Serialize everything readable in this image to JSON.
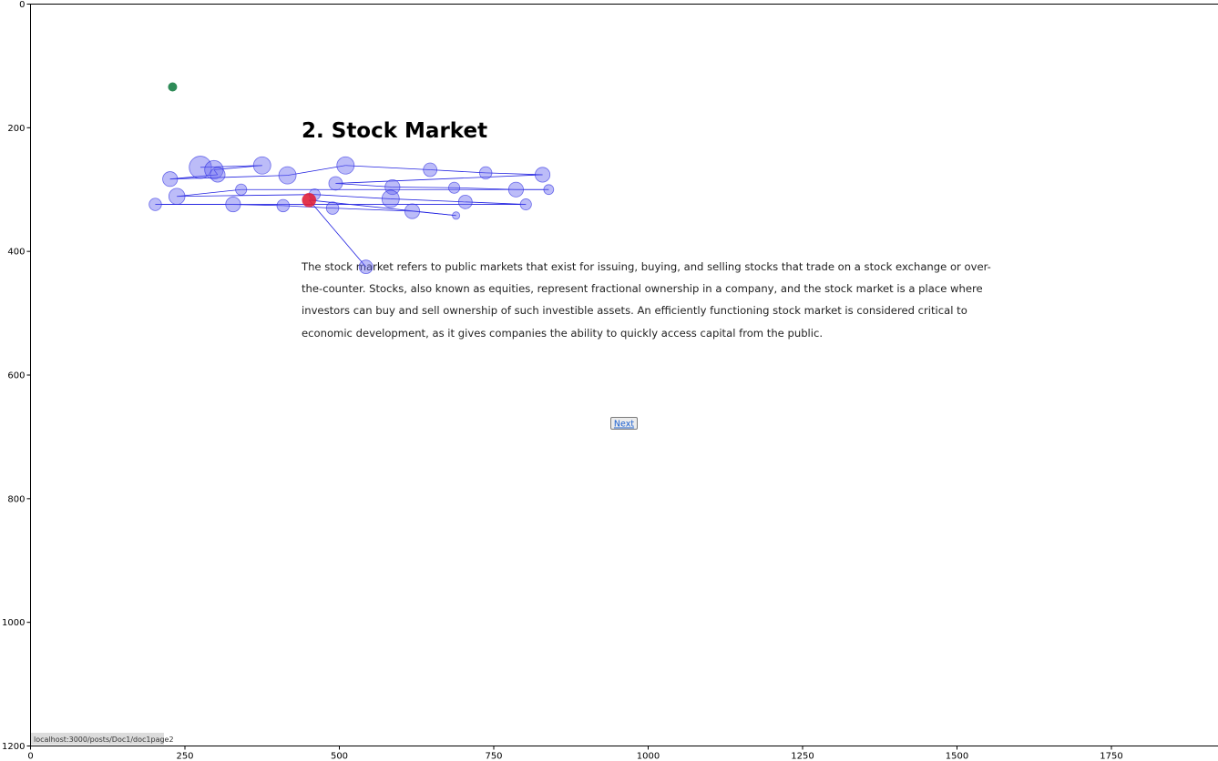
{
  "page": {
    "title": "2. Stock Market",
    "paragraph_lines": [
      "The stock market refers to public markets that exist for issuing, buying, and selling stocks that trade on a stock exchange or over-",
      "the-counter. Stocks, also known as equities, represent fractional ownership in a company, and the stock market is a place where",
      "investors can buy and sell ownership of such investible assets. An efficiently functioning stock market is considered critical to",
      "economic development, as it gives companies the ability to quickly access capital from the public."
    ],
    "next_label": "Next",
    "status_url": "localhost:3000/posts/Doc1/doc1page2"
  },
  "colors": {
    "fixation": "#6a6af0",
    "scanpath": "#2020e0",
    "current_fixation": "#e0203a",
    "start_point": "#2e8b57",
    "axis": "#000000"
  },
  "chart_data": {
    "type": "scatter",
    "xlim": [
      0,
      1920
    ],
    "ylim": [
      1200,
      0
    ],
    "x_ticks": [
      0,
      250,
      500,
      750,
      1000,
      1250,
      1500,
      1750
    ],
    "y_ticks": [
      0,
      200,
      400,
      600,
      800,
      1000,
      1200
    ],
    "title": "",
    "xlabel": "",
    "ylabel": "",
    "start_point": {
      "x": 230,
      "y": 134
    },
    "scanpath": [
      {
        "x": 275,
        "y": 264,
        "r": 18
      },
      {
        "x": 375,
        "y": 261,
        "r": 14
      },
      {
        "x": 297,
        "y": 268,
        "r": 15
      },
      {
        "x": 303,
        "y": 276,
        "r": 12
      },
      {
        "x": 226,
        "y": 283,
        "r": 12
      },
      {
        "x": 416,
        "y": 277,
        "r": 14
      },
      {
        "x": 510,
        "y": 261,
        "r": 14
      },
      {
        "x": 647,
        "y": 268,
        "r": 11
      },
      {
        "x": 737,
        "y": 273,
        "r": 10
      },
      {
        "x": 829,
        "y": 276,
        "r": 12
      },
      {
        "x": 494,
        "y": 290,
        "r": 11
      },
      {
        "x": 586,
        "y": 296,
        "r": 12
      },
      {
        "x": 686,
        "y": 297,
        "r": 9
      },
      {
        "x": 786,
        "y": 300,
        "r": 12
      },
      {
        "x": 839,
        "y": 300,
        "r": 8
      },
      {
        "x": 341,
        "y": 300,
        "r": 9
      },
      {
        "x": 237,
        "y": 311,
        "r": 13
      },
      {
        "x": 460,
        "y": 308,
        "r": 9
      },
      {
        "x": 583,
        "y": 315,
        "r": 14
      },
      {
        "x": 704,
        "y": 320,
        "r": 11
      },
      {
        "x": 802,
        "y": 324,
        "r": 9
      },
      {
        "x": 202,
        "y": 324,
        "r": 10
      },
      {
        "x": 328,
        "y": 324,
        "r": 12
      },
      {
        "x": 409,
        "y": 326,
        "r": 10
      },
      {
        "x": 489,
        "y": 330,
        "r": 10
      },
      {
        "x": 618,
        "y": 335,
        "r": 12
      },
      {
        "x": 689,
        "y": 342,
        "r": 6
      },
      {
        "x": 451,
        "y": 317,
        "r": 11
      },
      {
        "x": 543,
        "y": 425,
        "r": 11
      }
    ],
    "current_index": 27
  }
}
